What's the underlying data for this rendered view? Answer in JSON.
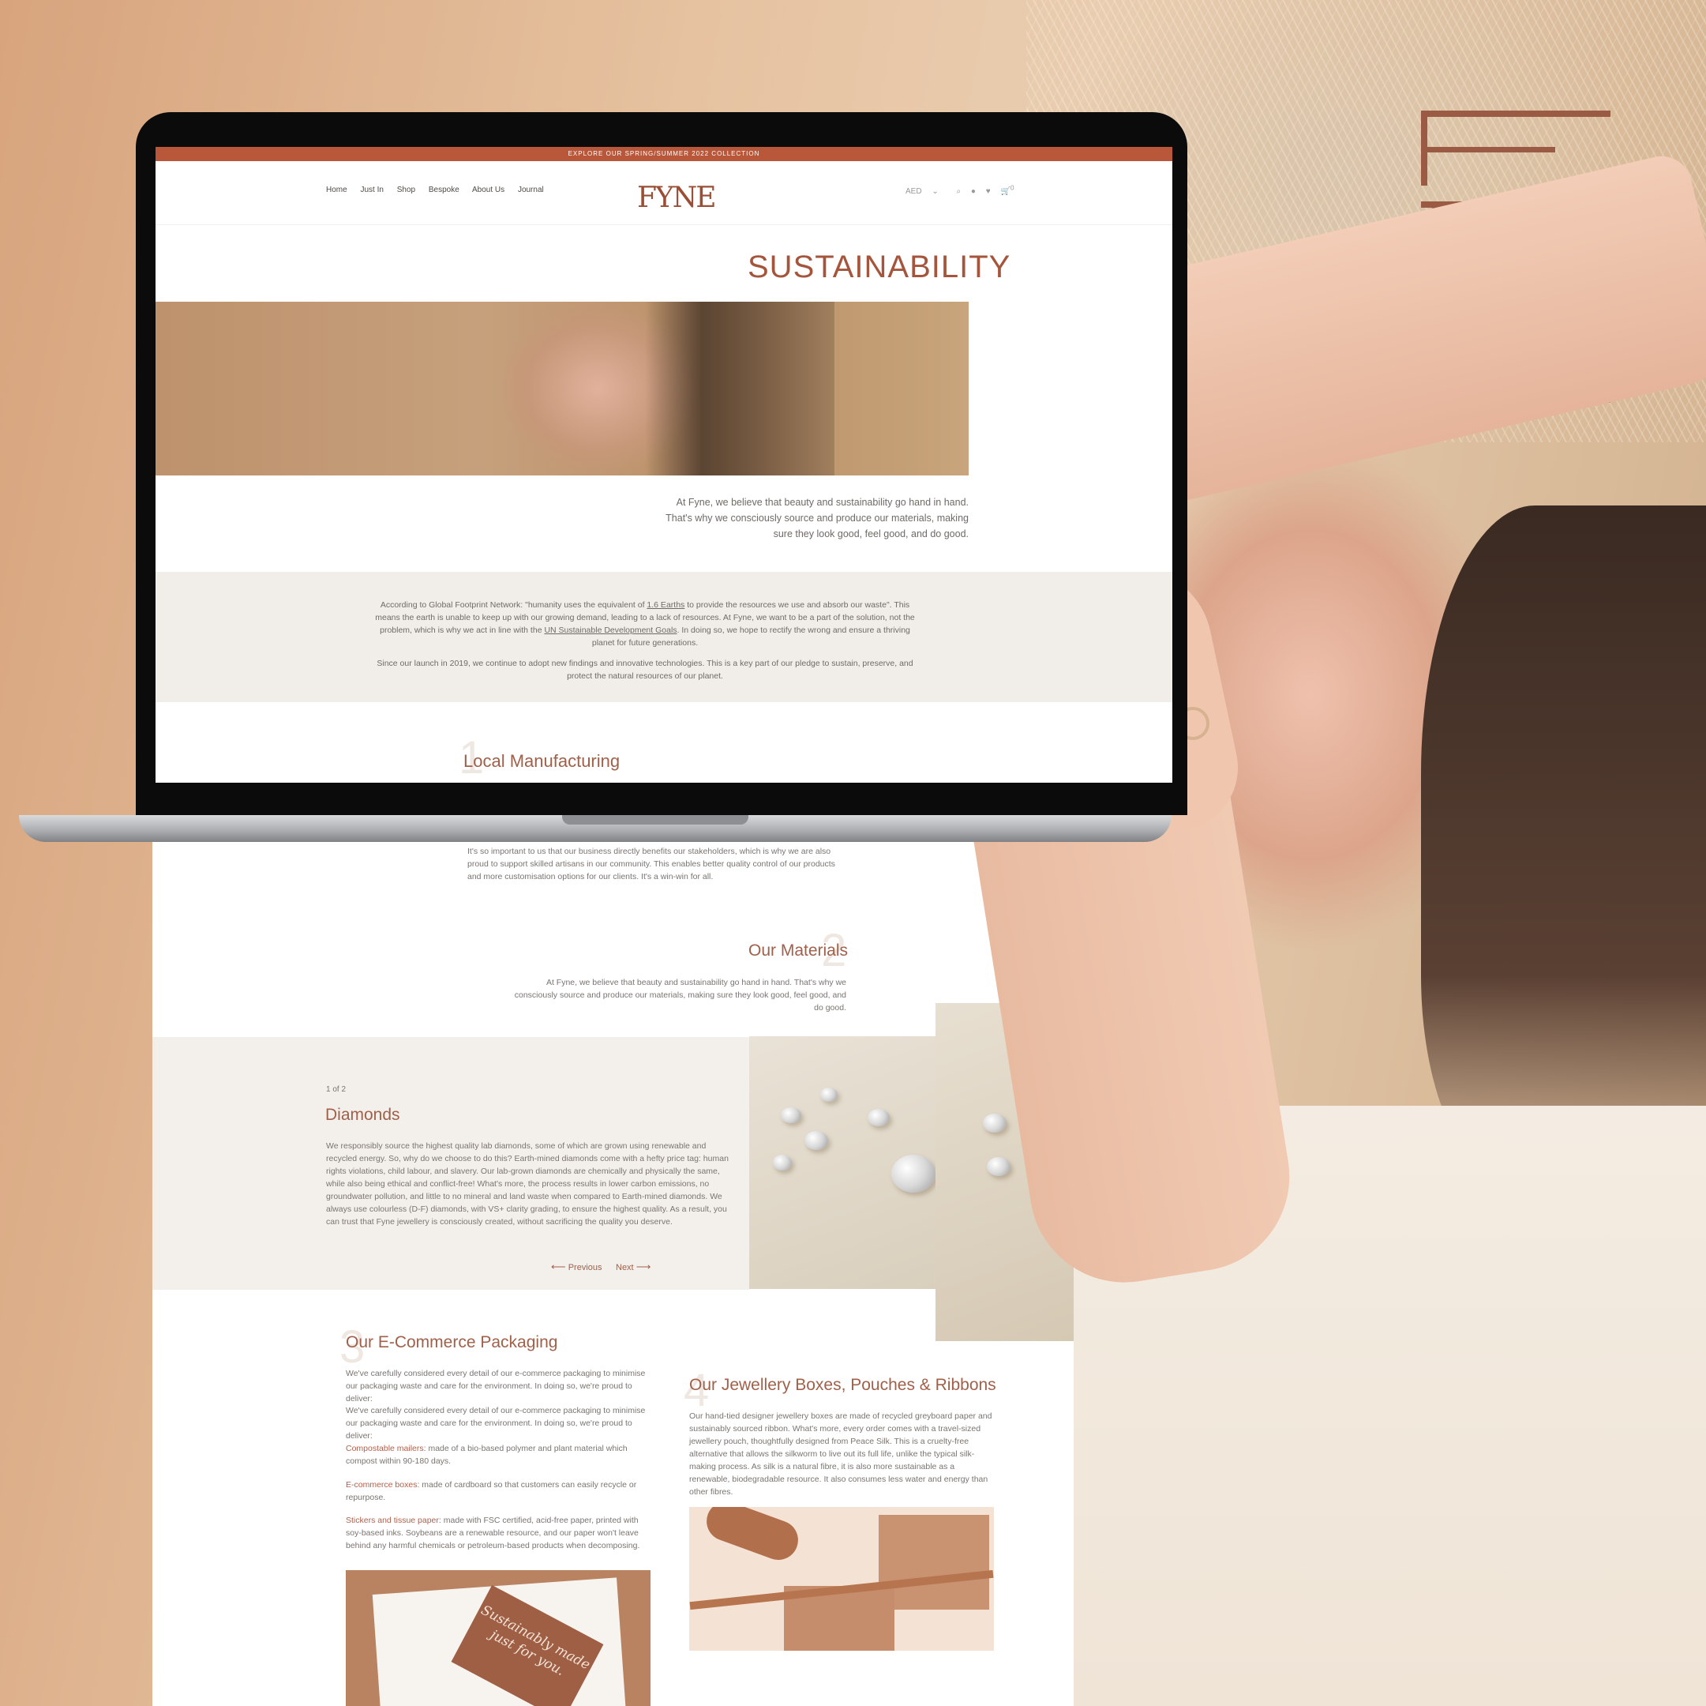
{
  "brand": {
    "vertical_logo": "FYNE",
    "accent": "#a0604a",
    "bar_color": "#b8573a"
  },
  "site": {
    "announcement": "EXPLORE OUR SPRING/SUMMER 2022 COLLECTION",
    "nav": [
      "Home",
      "Just In",
      "Shop",
      "Bespoke",
      "About Us",
      "Journal"
    ],
    "logo": "FYNE",
    "currency": "AED",
    "cart_count": "0",
    "page_title": "SUSTAINABILITY",
    "intro": "At Fyne, we believe that beauty and sustainability go hand in hand. That's why we consciously source and produce our materials, making sure they look good, feel good, and do good.",
    "band_p1_a": "According to Global Footprint Network: \"humanity uses the equivalent of ",
    "band_p1_link": "1.6 Earths",
    "band_p1_b": " to provide the resources we use and absorb our waste\". This means the earth is unable to keep up with our growing demand, leading to a lack of resources. At Fyne, we want to be a part of the solution, not the problem, which is why we act in line with the ",
    "band_p1_link2": "UN Sustainable Development Goals",
    "band_p1_c": ". In doing so, we hope to rectify the wrong and ensure a thriving planet for future generations.",
    "band_p2": "Since our launch in 2019, we continue to adopt new findings and innovative technologies. This is a key part of our pledge to sustain, preserve, and protect the natural resources of our planet."
  },
  "sections": {
    "local": {
      "num": "1",
      "title": "Local Manufacturing",
      "body": "It's so important to us that our business directly benefits our stakeholders, which is why we are also proud to support skilled artisans in our community. This enables better quality control of our products and more customisation options for our clients. It's a win-win for all."
    },
    "materials": {
      "num": "2",
      "title": "Our Materials",
      "body": "At Fyne, we believe that beauty and sustainability go hand in hand. That's why we consciously source and produce our materials, making sure they look good, feel good, and do good."
    },
    "slide": {
      "counter": "1 of 2",
      "title": "Diamonds",
      "body": "We responsibly source the highest quality lab diamonds, some of which are grown using renewable and recycled energy. So, why do we choose to do this? Earth-mined diamonds come with a hefty price tag: human rights violations, child labour, and slavery. Our lab-grown diamonds are chemically and physically the same, while also being ethical and conflict-free! What's more, the process results in lower carbon emissions, no groundwater pollution, and little to no mineral and land waste when compared to Earth-mined diamonds. We always use colourless (D-F) diamonds, with VS+ clarity grading, to ensure the highest quality. As a result, you can trust that Fyne jewellery is consciously created, without sacrificing the quality you deserve.",
      "prev": "Previous",
      "next": "Next"
    },
    "packaging": {
      "num": "3",
      "title": "Our E-Commerce Packaging",
      "intro1": "We've carefully considered every detail of our e-commerce packaging to minimise our packaging waste and care for the environment. In doing so, we're proud to deliver:",
      "intro2": "We've carefully considered every detail of our e-commerce packaging to minimise our packaging waste and care for the environment. In doing so, we're proud to deliver:",
      "items": [
        {
          "label": "Compostable mailers:",
          "text": " made of a bio-based polymer and plant material which compost within 90-180 days."
        },
        {
          "label": "E-commerce boxes:",
          "text": " made of cardboard so that customers can easily recycle or repurpose."
        },
        {
          "label": "Stickers and tissue paper:",
          "text": " made with FSC certified, acid-free paper, printed with soy-based inks. Soybeans are a renewable resource, and our paper won't leave behind any harmful chemicals or petroleum-based products when decomposing."
        }
      ],
      "card_text": "Sustainably made just for you."
    },
    "boxes": {
      "num": "4",
      "title": "Our Jewellery Boxes, Pouches & Ribbons",
      "body": "Our hand-tied designer jewellery boxes are made of recycled greyboard paper and sustainably sourced ribbon. What's more, every order comes with a travel-sized jewellery pouch, thoughtfully designed from Peace Silk. This is a cruelty-free alternative that allows the silkworm to live out its full life, unlike the typical silk-making process. As silk is a natural fibre, it is also more sustainable as a renewable, biodegradable resource. It also consumes less water and energy than other fibres."
    }
  }
}
